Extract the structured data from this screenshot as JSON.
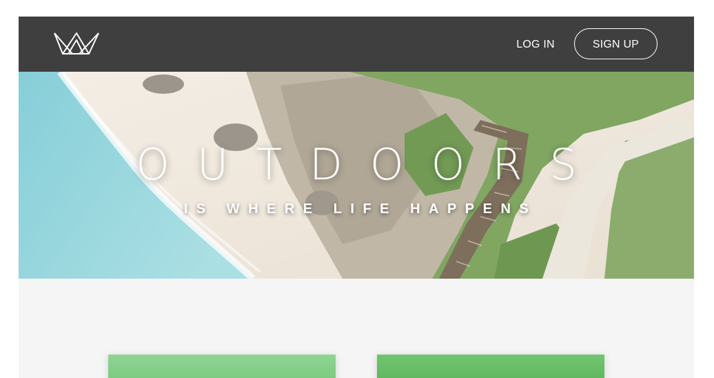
{
  "nav": {
    "logo_icon": "crown-logo-icon",
    "login_label": "LOG IN",
    "signup_label": "SIGN UP"
  },
  "hero": {
    "title": "OUTDOORS",
    "subtitle": "IS WHERE LIFE HAPPENS"
  },
  "colors": {
    "navbar": "#3f3f3f",
    "page_background": "#f5f5f5",
    "sea": "#7ccfd6",
    "sand": "#efe5d7",
    "vegetation": "#6f9a4c",
    "card_green_1": "#8ed493",
    "card_green_2": "#66b963"
  }
}
